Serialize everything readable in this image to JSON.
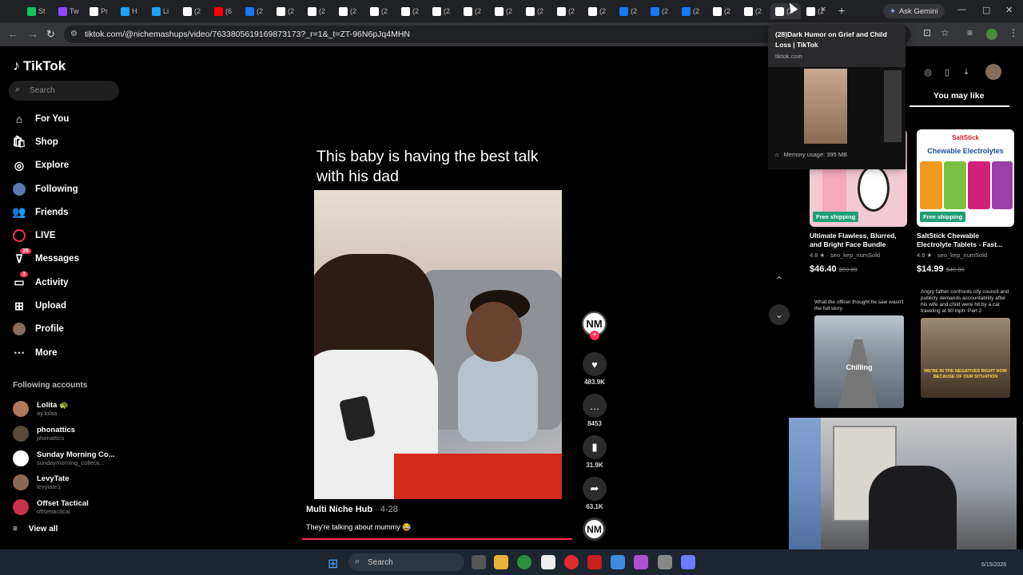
{
  "browser": {
    "tabs": [
      {
        "label": "St",
        "icon": "kofi-icon",
        "color": "#13c35b"
      },
      {
        "label": "Tw",
        "icon": "twitch-icon",
        "color": "#9146ff"
      },
      {
        "label": "Pr",
        "icon": "diamond-icon",
        "color": "#ffffff"
      },
      {
        "label": "H",
        "icon": "round-icon",
        "color": "#1da1f2"
      },
      {
        "label": "Li",
        "icon": "round-icon",
        "color": "#1da1f2"
      },
      {
        "label": "(2",
        "icon": "tiktok-icon",
        "color": "#ffffff"
      },
      {
        "label": "(6",
        "icon": "youtube-icon",
        "color": "#ff0000"
      },
      {
        "label": "(2",
        "icon": "facebook-icon",
        "color": "#1877f2"
      },
      {
        "label": "(2",
        "icon": "tiktok-icon",
        "color": "#ffffff"
      },
      {
        "label": "(2",
        "icon": "tiktok-icon",
        "color": "#ffffff"
      },
      {
        "label": "(2",
        "icon": "tiktok-icon",
        "color": "#ffffff"
      },
      {
        "label": "(2",
        "icon": "tiktok-icon",
        "color": "#ffffff"
      },
      {
        "label": "(2",
        "icon": "tiktok-icon",
        "color": "#ffffff"
      },
      {
        "label": "(2",
        "icon": "tiktok-icon",
        "color": "#ffffff"
      },
      {
        "label": "(2",
        "icon": "tiktok-icon",
        "color": "#ffffff"
      },
      {
        "label": "(2",
        "icon": "tiktok-icon",
        "color": "#ffffff"
      },
      {
        "label": "(2",
        "icon": "tiktok-icon",
        "color": "#ffffff"
      },
      {
        "label": "(2",
        "icon": "tiktok-icon",
        "color": "#ffffff"
      },
      {
        "label": "(2",
        "icon": "tiktok-icon",
        "color": "#ffffff"
      },
      {
        "label": "(2",
        "icon": "facebook-icon",
        "color": "#1877f2"
      },
      {
        "label": "(2",
        "icon": "facebook-icon",
        "color": "#1877f2"
      },
      {
        "label": "(2",
        "icon": "facebook-icon",
        "color": "#1877f2"
      },
      {
        "label": "(2",
        "icon": "tiktok-icon",
        "color": "#ffffff"
      },
      {
        "label": "(2",
        "icon": "tiktok-icon",
        "color": "#ffffff"
      },
      {
        "label": "(2",
        "icon": "tiktok-icon",
        "color": "#ffffff"
      },
      {
        "label": "(2",
        "icon": "tiktok-icon",
        "color": "#ffffff"
      }
    ],
    "active_tab_close": "×",
    "new_tab": "+",
    "ask_gemini": "Ask Gemini",
    "url": "tiktok.com/@nichemashups/video/7633805619169873173?_r=1&_t=ZT-96N6pJq4MHN",
    "window_controls": [
      "—",
      "▢",
      "✕"
    ]
  },
  "hover_preview": {
    "title": "(28)Dark Humor on Grief and Child Loss | TikTok",
    "domain": "tiktok.com",
    "memory": "Memory usage: 395 MB"
  },
  "sidebar": {
    "logo": "TikTok",
    "search_placeholder": "Search",
    "nav": [
      {
        "label": "For You",
        "icon": "home-icon",
        "glyph": "⌂"
      },
      {
        "label": "Shop",
        "icon": "shop-icon",
        "glyph": "🛍"
      },
      {
        "label": "Explore",
        "icon": "compass-icon",
        "glyph": "◎"
      },
      {
        "label": "Following",
        "icon": "following-avatar-icon",
        "glyph": "●"
      },
      {
        "label": "Friends",
        "icon": "friends-icon",
        "glyph": "👥"
      },
      {
        "label": "LIVE",
        "icon": "live-icon",
        "glyph": "◉"
      },
      {
        "label": "Messages",
        "icon": "messages-icon",
        "glyph": "⊽",
        "badge": "25"
      },
      {
        "label": "Activity",
        "icon": "activity-icon",
        "glyph": "▭",
        "badge": "3"
      },
      {
        "label": "Upload",
        "icon": "upload-icon",
        "glyph": "⊞"
      },
      {
        "label": "Profile",
        "icon": "profile-avatar-icon",
        "glyph": "●"
      },
      {
        "label": "More",
        "icon": "more-icon",
        "glyph": "⋯"
      }
    ],
    "following_title": "Following accounts",
    "following": [
      {
        "name": "Lolita 🐢",
        "handle": "ay.lolaa",
        "color": "#b0785e"
      },
      {
        "name": "phonattics",
        "handle": "phonattics",
        "color": "#5a4a3a"
      },
      {
        "name": "Sunday Morning Co...",
        "handle": "sundaymorning_collecti...",
        "color": "#ffffff"
      },
      {
        "name": "LevyTate",
        "handle": "levytate1",
        "color": "#8a6a55"
      },
      {
        "name": "Offset Tactical",
        "handle": "offsettactical",
        "color": "#c8324b"
      }
    ],
    "view_all": "View all"
  },
  "video": {
    "caption": "This baby is having the best talk with his dad",
    "author": "Multi Niche Hub",
    "date": " · 4-28",
    "description": "They're talking about mummy 😂",
    "creator_initials": "NM",
    "actions": [
      {
        "icon": "heart-icon",
        "glyph": "♥",
        "count": "483.9K"
      },
      {
        "icon": "comment-icon",
        "glyph": "…",
        "count": "8453"
      },
      {
        "icon": "bookmark-icon",
        "glyph": "▮",
        "count": "31.9K"
      },
      {
        "icon": "share-icon",
        "glyph": "➦",
        "count": "63.1K"
      }
    ]
  },
  "right_panel": {
    "you_may_like": "You may like",
    "products": [
      {
        "title": "Ultimate Flawless, Blurred, and Bright Face Bundle",
        "rating": "4.8 ★ · seo_kep_numSold",
        "price": "$46.40",
        "old_price": "$59.00",
        "shipping": "Free shipping",
        "bg": "#f3c9d4"
      },
      {
        "title": "SaltStick Chewable Electrolyte Tablets - Fast...",
        "rating": "4.6 ★ · seo_kep_numSold",
        "price": "$14.99",
        "old_price": "$40.00",
        "shipping": "Free shipping",
        "bg": "#ffffff",
        "brand": "SaltStick",
        "brand_tag": "Chewable Electrolytes"
      }
    ],
    "thumbs": [
      {
        "caption": "What the officer thought he saw wasn't the full story",
        "overlay": "Chilling",
        "bg": "#7c8790"
      },
      {
        "caption": "Angry father confronts city council and publicly demands accountability after his wife and child were hit by a car traveling at 90 mph: Part 2",
        "overlay": "WE'RE IN THE NEGATIVES RIGHT NOW BECAUSE OF OUR SITUATION",
        "bg": "#6e5b48"
      }
    ]
  },
  "taskbar": {
    "search": "Search",
    "date": "6/15/2026"
  }
}
